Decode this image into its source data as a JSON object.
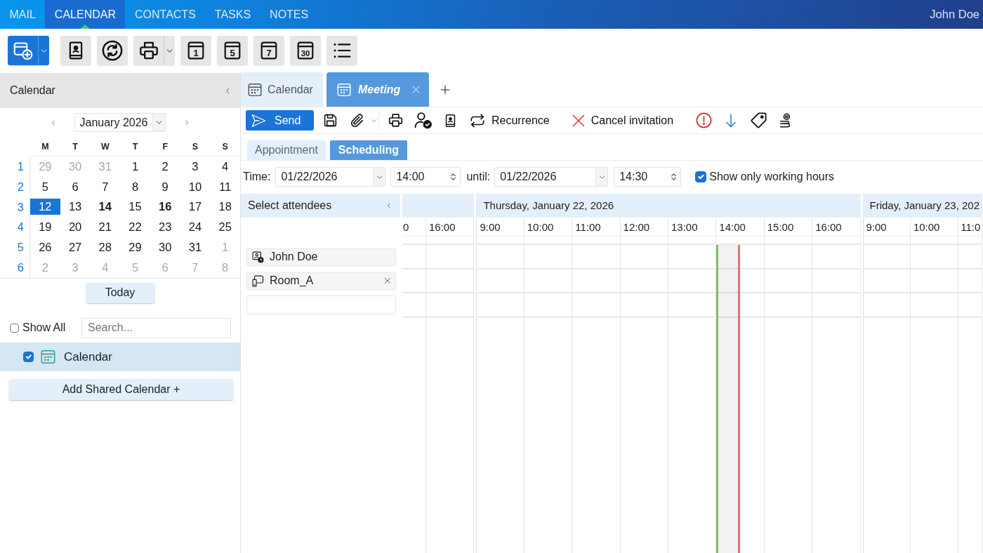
{
  "app_nav": {
    "tabs": [
      {
        "label": "MAIL",
        "selected": false
      },
      {
        "label": "CALENDAR",
        "selected": true
      },
      {
        "label": "CONTACTS",
        "selected": false
      },
      {
        "label": "TASKS",
        "selected": false
      },
      {
        "label": "NOTES",
        "selected": false
      }
    ],
    "user": "John Doe"
  },
  "main_toolbar": {
    "view_buttons": [
      {
        "label": "1"
      },
      {
        "label": "5"
      },
      {
        "label": "7"
      },
      {
        "label": "30"
      }
    ]
  },
  "sidebar": {
    "title": "Calendar",
    "mini_calendar": {
      "month": "January 2026",
      "weekdays": [
        "M",
        "T",
        "W",
        "T",
        "F",
        "S",
        "S"
      ],
      "weeks": [
        {
          "number": "1",
          "days": [
            {
              "label": "29",
              "selected": false,
              "outside_month": true,
              "has_events": false
            },
            {
              "label": "30",
              "selected": false,
              "outside_month": true,
              "has_events": false
            },
            {
              "label": "31",
              "selected": false,
              "outside_month": true,
              "has_events": false
            },
            {
              "label": "1",
              "selected": false,
              "outside_month": false,
              "has_events": false
            },
            {
              "label": "2",
              "selected": false,
              "outside_month": false,
              "has_events": false
            },
            {
              "label": "3",
              "selected": false,
              "outside_month": false,
              "has_events": false
            },
            {
              "label": "4",
              "selected": false,
              "outside_month": false,
              "has_events": false
            }
          ]
        },
        {
          "number": "2",
          "days": [
            {
              "label": "5",
              "selected": false,
              "outside_month": false,
              "has_events": false
            },
            {
              "label": "6",
              "selected": false,
              "outside_month": false,
              "has_events": false
            },
            {
              "label": "7",
              "selected": false,
              "outside_month": false,
              "has_events": false
            },
            {
              "label": "8",
              "selected": false,
              "outside_month": false,
              "has_events": false
            },
            {
              "label": "9",
              "selected": false,
              "outside_month": false,
              "has_events": false
            },
            {
              "label": "10",
              "selected": false,
              "outside_month": false,
              "has_events": false
            },
            {
              "label": "11",
              "selected": false,
              "outside_month": false,
              "has_events": false
            }
          ]
        },
        {
          "number": "3",
          "days": [
            {
              "label": "12",
              "selected": true,
              "outside_month": false,
              "has_events": false
            },
            {
              "label": "13",
              "selected": false,
              "outside_month": false,
              "has_events": false
            },
            {
              "label": "14",
              "selected": false,
              "outside_month": false,
              "has_events": true
            },
            {
              "label": "15",
              "selected": false,
              "outside_month": false,
              "has_events": false
            },
            {
              "label": "16",
              "selected": false,
              "outside_month": false,
              "has_events": true
            },
            {
              "label": "17",
              "selected": false,
              "outside_month": false,
              "has_events": false
            },
            {
              "label": "18",
              "selected": false,
              "outside_month": false,
              "has_events": false
            }
          ]
        },
        {
          "number": "4",
          "days": [
            {
              "label": "19",
              "selected": false,
              "outside_month": false,
              "has_events": false
            },
            {
              "label": "20",
              "selected": false,
              "outside_month": false,
              "has_events": false
            },
            {
              "label": "21",
              "selected": false,
              "outside_month": false,
              "has_events": false
            },
            {
              "label": "22",
              "selected": false,
              "outside_month": false,
              "has_events": false
            },
            {
              "label": "23",
              "selected": false,
              "outside_month": false,
              "has_events": false
            },
            {
              "label": "24",
              "selected": false,
              "outside_month": false,
              "has_events": false
            },
            {
              "label": "25",
              "selected": false,
              "outside_month": false,
              "has_events": false
            }
          ]
        },
        {
          "number": "5",
          "days": [
            {
              "label": "26",
              "selected": false,
              "outside_month": false,
              "has_events": false
            },
            {
              "label": "27",
              "selected": false,
              "outside_month": false,
              "has_events": false
            },
            {
              "label": "28",
              "selected": false,
              "outside_month": false,
              "has_events": false
            },
            {
              "label": "29",
              "selected": false,
              "outside_month": false,
              "has_events": false
            },
            {
              "label": "30",
              "selected": false,
              "outside_month": false,
              "has_events": false
            },
            {
              "label": "31",
              "selected": false,
              "outside_month": false,
              "has_events": false
            },
            {
              "label": "1",
              "selected": false,
              "outside_month": true,
              "has_events": false
            }
          ]
        },
        {
          "number": "6",
          "days": [
            {
              "label": "2",
              "selected": false,
              "outside_month": true,
              "has_events": false
            },
            {
              "label": "3",
              "selected": false,
              "outside_month": true,
              "has_events": false
            },
            {
              "label": "4",
              "selected": false,
              "outside_month": true,
              "has_events": false
            },
            {
              "label": "5",
              "selected": false,
              "outside_month": true,
              "has_events": false
            },
            {
              "label": "6",
              "selected": false,
              "outside_month": true,
              "has_events": false
            },
            {
              "label": "7",
              "selected": false,
              "outside_month": true,
              "has_events": false
            },
            {
              "label": "8",
              "selected": false,
              "outside_month": true,
              "has_events": false
            }
          ]
        }
      ]
    },
    "today_button": "Today",
    "show_all": {
      "label": "Show All",
      "checked": false
    },
    "search": {
      "placeholder": "Search..."
    },
    "calendars": [
      {
        "name": "Calendar",
        "checked": true,
        "selected": true,
        "color": "#2e9e78"
      }
    ],
    "add_shared_button": "Add Shared Calendar +"
  },
  "editor_tabs": [
    {
      "label": "Calendar",
      "selected": false,
      "closable": false
    },
    {
      "label": "Meeting",
      "selected": true,
      "closable": true
    }
  ],
  "meeting_toolbar": {
    "send": "Send",
    "recurrence": "Recurrence",
    "cancel_invitation": "Cancel invitation"
  },
  "form_tabs": [
    {
      "label": "Appointment",
      "selected": false
    },
    {
      "label": "Scheduling",
      "selected": true
    }
  ],
  "time_row": {
    "label": "Time:",
    "start_date": "01/22/2026",
    "start_time": "14:00",
    "until_label": "until:",
    "end_date": "01/22/2026",
    "end_time": "14:30",
    "working_hours": {
      "label": "Show only working hours",
      "checked": true
    }
  },
  "scheduling": {
    "attendees_title": "Select attendees",
    "attendees": [
      {
        "name": "John Doe",
        "kind": "organizer",
        "removable": false
      },
      {
        "name": "Room_A",
        "kind": "room",
        "removable": true
      }
    ],
    "days": [
      {
        "hours": [
          {
            "label": "0",
            "selected": false
          },
          {
            "label": "16:00",
            "selected": false
          }
        ]
      },
      {
        "title": "Thursday, January 22, 2026",
        "hours": [
          {
            "label": "9:00",
            "selected": false
          },
          {
            "label": "10:00",
            "selected": false
          },
          {
            "label": "11:00",
            "selected": false
          },
          {
            "label": "12:00",
            "selected": false
          },
          {
            "label": "13:00",
            "selected": false
          },
          {
            "label": "14:00",
            "selected": true
          },
          {
            "label": "15:00",
            "selected": false
          },
          {
            "label": "16:00",
            "selected": false
          }
        ]
      },
      {
        "title": "Friday, January 23, 202",
        "hours": [
          {
            "label": "9:00",
            "selected": false
          },
          {
            "label": "10:00",
            "selected": false
          },
          {
            "label": "11:0",
            "selected": false
          }
        ]
      }
    ]
  }
}
